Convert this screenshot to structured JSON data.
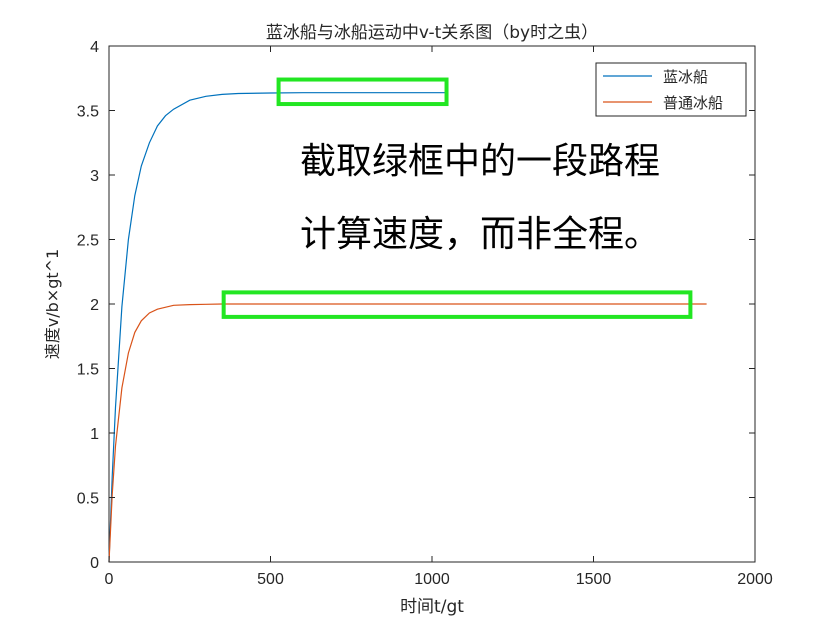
{
  "chart_data": {
    "type": "line",
    "title": "蓝冰船与冰船运动中v-t关系图（by时之虫）",
    "xlabel": "时间t/gt",
    "ylabel": "速度v/b×gt^1",
    "xlim": [
      0,
      2000
    ],
    "ylim": [
      0,
      4
    ],
    "x_ticks": [
      "0",
      "500",
      "1000",
      "1500",
      "2000"
    ],
    "y_ticks": [
      "0",
      "0.5",
      "1",
      "1.5",
      "2",
      "2.5",
      "3",
      "3.5",
      "4"
    ],
    "grid": false,
    "legend_position": "top-right",
    "series": [
      {
        "name": "蓝冰船",
        "color": "#0072BD",
        "x": [
          0,
          10,
          20,
          40,
          60,
          80,
          100,
          125,
          150,
          175,
          200,
          250,
          300,
          350,
          400,
          500,
          600,
          700,
          800,
          900,
          1000,
          1050
        ],
        "y": [
          0,
          0.66,
          1.2,
          1.98,
          2.5,
          2.84,
          3.07,
          3.25,
          3.38,
          3.46,
          3.51,
          3.58,
          3.61,
          3.625,
          3.632,
          3.636,
          3.638,
          3.638,
          3.638,
          3.638,
          3.638,
          3.638
        ]
      },
      {
        "name": "普通冰船",
        "color": "#D95319",
        "x": [
          0,
          10,
          20,
          40,
          60,
          80,
          100,
          125,
          150,
          200,
          250,
          300,
          350,
          400,
          500,
          800,
          1200,
          1600,
          1850
        ],
        "y": [
          0,
          0.52,
          0.9,
          1.35,
          1.62,
          1.78,
          1.87,
          1.93,
          1.96,
          1.99,
          1.995,
          1.998,
          2.0,
          2.0,
          2.0,
          2.0,
          2.0,
          2.0,
          2.0
        ]
      }
    ],
    "highlight_boxes": [
      {
        "x0": 525,
        "x1": 1045,
        "y0": 3.55,
        "y1": 3.74,
        "color": "#22E622"
      },
      {
        "x0": 355,
        "x1": 1800,
        "y0": 1.9,
        "y1": 2.09,
        "color": "#22E622"
      }
    ],
    "annotations": [
      "截取绿框中的一段路程",
      "计算速度，而非全程。"
    ]
  }
}
